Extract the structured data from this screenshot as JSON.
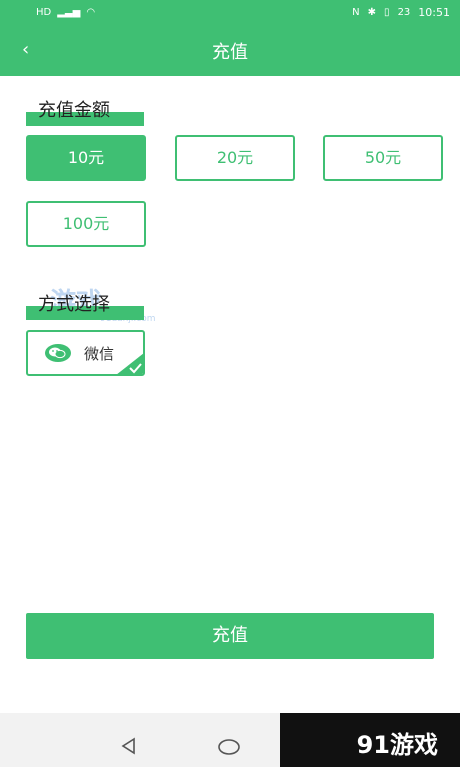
{
  "status": {
    "time": "10:51",
    "battery": "23",
    "network_icons": [
      "hd-icon",
      "signal-icon",
      "wifi-icon"
    ],
    "right_icons": [
      "nfc-icon",
      "bluetooth-icon",
      "vibrate-icon",
      "battery-icon"
    ]
  },
  "header": {
    "title": "充值",
    "back_icon": "chevron-left-icon"
  },
  "recharge": {
    "heading": "充值金额",
    "amounts": [
      {
        "label": "10元",
        "selected": true
      },
      {
        "label": "20元",
        "selected": false
      },
      {
        "label": "50元",
        "selected": false
      },
      {
        "label": "100元",
        "selected": false
      }
    ]
  },
  "method": {
    "heading": "方式选择",
    "options": [
      {
        "label": "微信",
        "icon": "wechat-icon",
        "selected": true
      }
    ]
  },
  "submit": {
    "label": "充值"
  },
  "watermark": {
    "soft_text": "游戏",
    "soft_sub": "91danji.com",
    "corner_text": "91游戏"
  },
  "colors": {
    "accent": "#3fbf73"
  }
}
